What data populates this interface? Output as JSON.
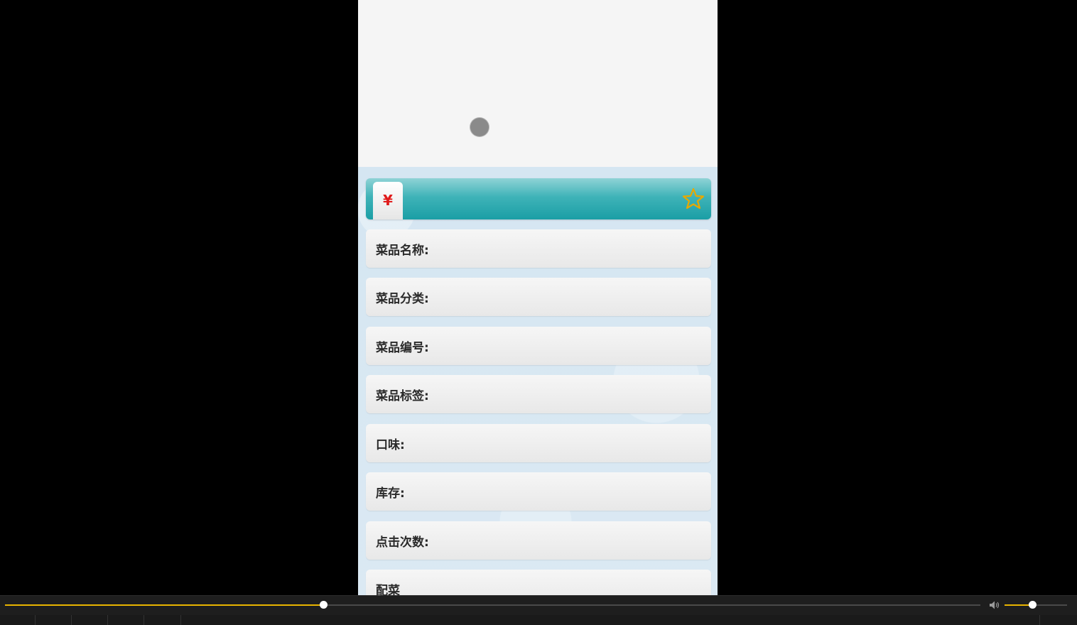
{
  "dish_detail": {
    "price_symbol": "¥",
    "fields": [
      {
        "label": "菜品名称:"
      },
      {
        "label": "菜品分类:"
      },
      {
        "label": "菜品编号:"
      },
      {
        "label": "菜品标签:"
      },
      {
        "label": "口味:"
      },
      {
        "label": "库存:"
      },
      {
        "label": "点击次数:"
      },
      {
        "label": "配菜"
      }
    ],
    "star_icon": "star-outline-icon",
    "colors": {
      "price_bar": "#1a9ea5",
      "price_symbol": "#e01b1b",
      "star": "#e8a800"
    }
  },
  "player": {
    "seek_progress": 0.326,
    "volume_level": 0.44,
    "volume_icon": "speaker-icon",
    "accent": "#e8b400"
  }
}
